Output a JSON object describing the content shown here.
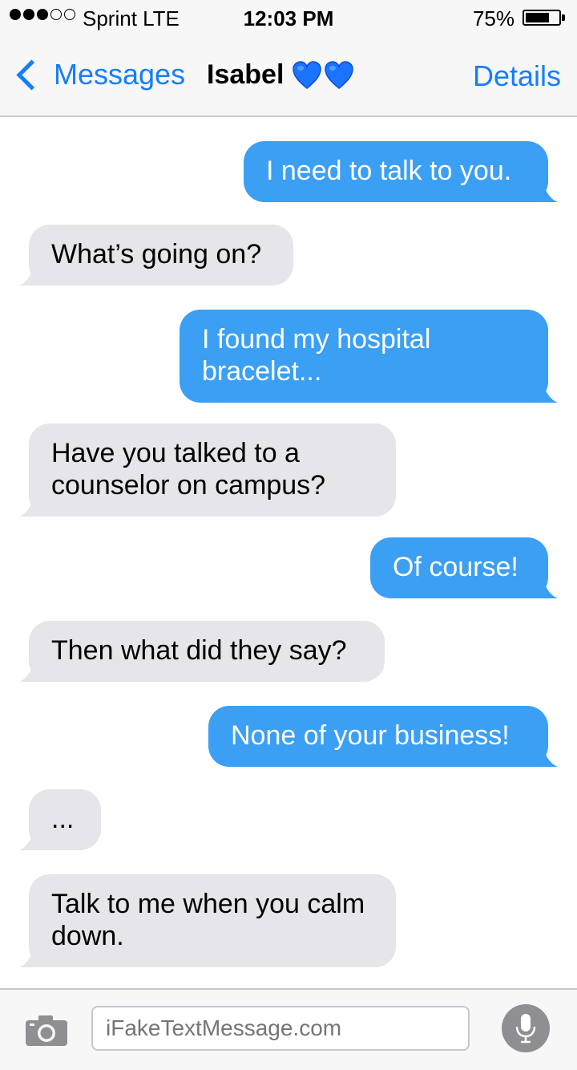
{
  "status_bar": {
    "carrier": "Sprint  LTE",
    "time": "12:03 PM",
    "battery_percent": "75%",
    "battery_level": 0.75,
    "signal_bars_filled": 3,
    "signal_bars_total": 5
  },
  "nav": {
    "back_label": "Messages",
    "title": "Isabel",
    "title_icons": [
      "blue-heart-icon",
      "blue-heart-icon"
    ],
    "details_label": "Details"
  },
  "colors": {
    "accent": "#157efb",
    "sent_bubble": "#3b9ff4",
    "received_bubble": "#e5e5ea",
    "heart": "#1a74ff"
  },
  "messages": [
    {
      "direction": "sent",
      "text": "I need to talk to you."
    },
    {
      "direction": "received",
      "text": "What’s going on?"
    },
    {
      "direction": "sent",
      "text": "I found my hospital bracelet..."
    },
    {
      "direction": "received",
      "text": "Have you talked to a counselor on campus?"
    },
    {
      "direction": "sent",
      "text": "Of course!"
    },
    {
      "direction": "received",
      "text": "Then what did they say?"
    },
    {
      "direction": "sent",
      "text": "None of your business!"
    },
    {
      "direction": "received",
      "text": "..."
    },
    {
      "direction": "received",
      "text": "Talk to me when you calm down."
    }
  ],
  "input": {
    "placeholder": "iFakeTextMessage.com",
    "camera_icon": "camera-icon",
    "mic_icon": "microphone-icon"
  }
}
